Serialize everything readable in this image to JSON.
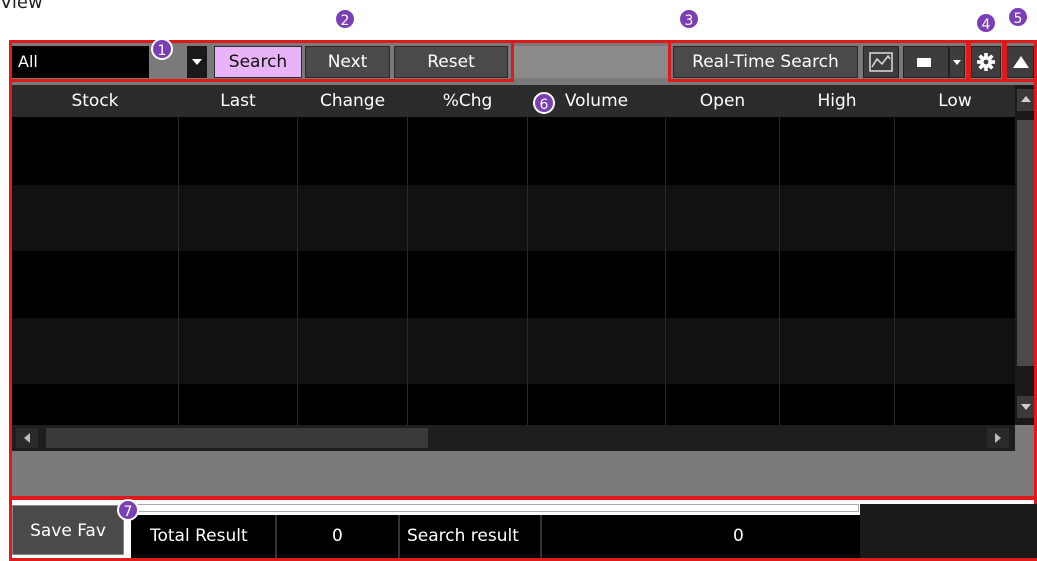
{
  "view_label": "View",
  "badges": [
    "1",
    "2",
    "3",
    "4",
    "5",
    "6",
    "7"
  ],
  "toolbar": {
    "filter_value": "All",
    "search_label": "Search",
    "next_label": "Next",
    "reset_label": "Reset",
    "realtime_label": "Real-Time Search"
  },
  "grid": {
    "columns": [
      "Stock",
      "Last",
      "Change",
      "%Chg",
      "Volume",
      "Open",
      "High",
      "Low"
    ]
  },
  "footer": {
    "save_fav_label": "Save Fav",
    "total_result_label": "Total Result",
    "total_result_value": "0",
    "search_result_label": "Search result",
    "search_result_value": "0"
  },
  "colors": {
    "highlight_border": "#e01a1a",
    "badge": "#7b3fb5",
    "search_button": "#e8b4f7"
  },
  "icons": [
    "chevron-down-icon",
    "chart-icon",
    "square-icon",
    "gear-icon",
    "triangle-up-icon",
    "scroll-up-icon",
    "scroll-down-icon",
    "scroll-left-icon",
    "scroll-right-icon"
  ]
}
